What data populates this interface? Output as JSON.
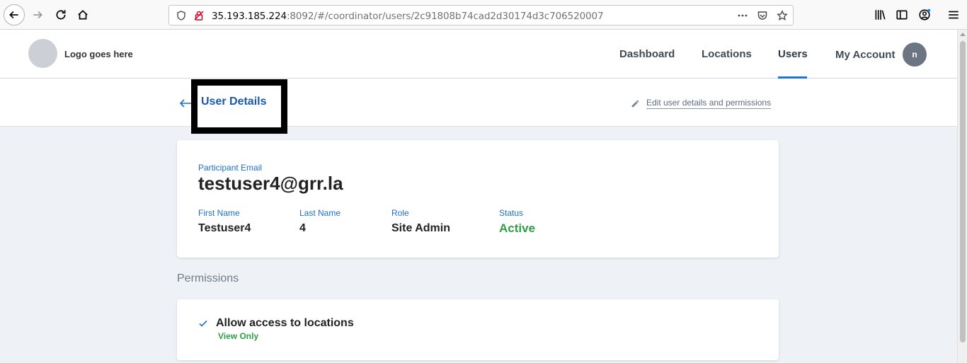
{
  "browser": {
    "url_host": "35.193.185.224",
    "url_rest": ":8092/#/coordinator/users/2c91808b74cad2d30174d3c706520007"
  },
  "header": {
    "logo_text": "Logo goes here",
    "nav": [
      "Dashboard",
      "Locations",
      "Users",
      "My Account"
    ],
    "active_nav": "Users",
    "avatar_initial": "n"
  },
  "page": {
    "title": "User Details",
    "edit_link": "Edit user details and permissions"
  },
  "details": {
    "email_label": "Participant Email",
    "email": "testuser4@grr.la",
    "first_name_label": "First Name",
    "first_name": "Testuser4",
    "last_name_label": "Last Name",
    "last_name": "4",
    "role_label": "Role",
    "role": "Site Admin",
    "status_label": "Status",
    "status": "Active"
  },
  "permissions": {
    "section_title": "Permissions",
    "items": [
      {
        "title": "Allow access to locations",
        "level": "View Only"
      }
    ]
  },
  "colors": {
    "accent": "#1a73e8",
    "status_active": "#2e9e47",
    "label_blue": "#1e6fd0"
  }
}
